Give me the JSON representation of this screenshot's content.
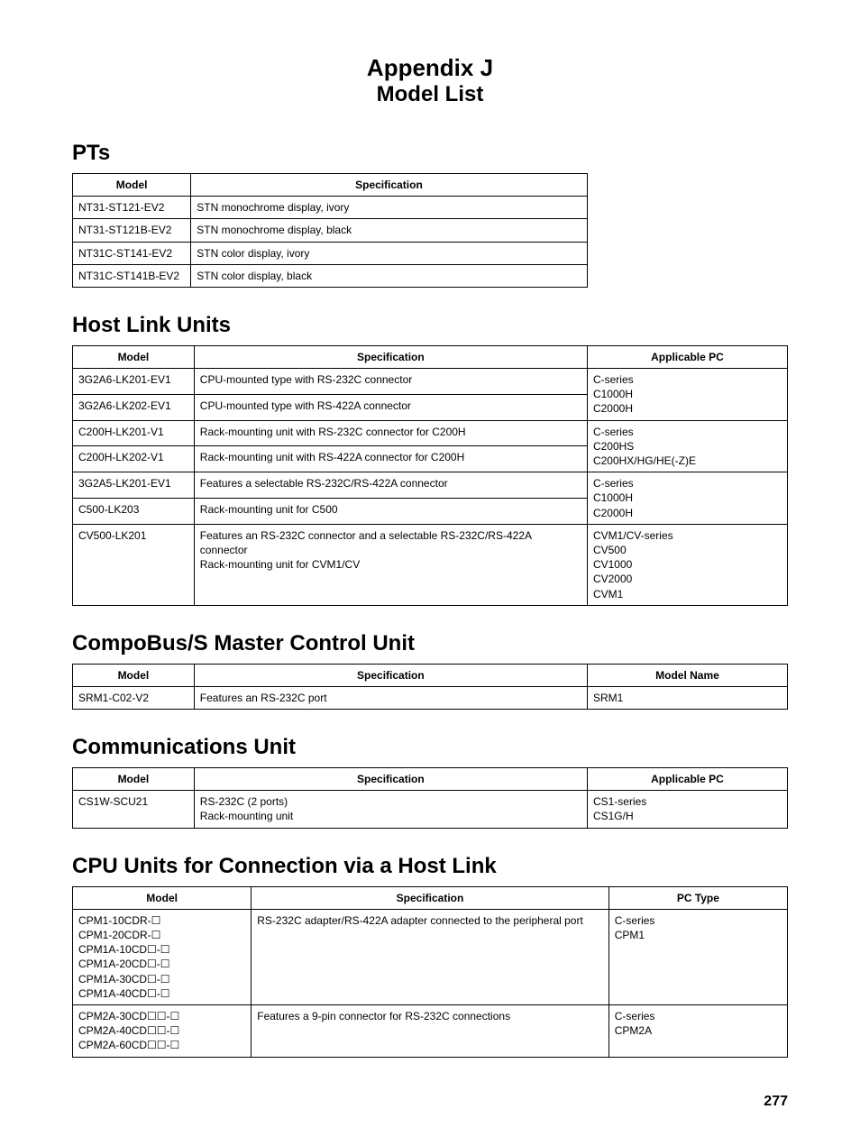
{
  "header": {
    "appendix": "Appendix J",
    "subtitle": "Model List"
  },
  "pts": {
    "heading": "PTs",
    "cols": [
      "Model",
      "Specification"
    ],
    "rows": [
      {
        "model": "NT31-ST121-EV2",
        "spec": "STN monochrome display, ivory"
      },
      {
        "model": "NT31-ST121B-EV2",
        "spec": "STN monochrome display, black"
      },
      {
        "model": "NT31C-ST141-EV2",
        "spec": "STN color display, ivory"
      },
      {
        "model": "NT31C-ST141B-EV2",
        "spec": "STN color display, black"
      }
    ]
  },
  "hostlink": {
    "heading": "Host Link Units",
    "cols": [
      "Model",
      "Specification",
      "Applicable PC"
    ],
    "rows": [
      {
        "model": "3G2A6-LK201-EV1",
        "spec": "CPU-mounted type with RS-232C connector",
        "pc_lines": [
          "C-series"
        ],
        "group_start": true
      },
      {
        "model": "3G2A6-LK202-EV1",
        "spec": "CPU-mounted type with RS-422A connector",
        "pc_lines": [
          "C1000H",
          "C2000H"
        ]
      },
      {
        "model": "C200H-LK201-V1",
        "spec": "Rack-mounting unit with RS-232C connector for C200H",
        "pc_lines": [
          "C-series"
        ],
        "group_start": true
      },
      {
        "model": "C200H-LK202-V1",
        "spec": "Rack-mounting unit with RS-422A connector for C200H",
        "pc_lines": [
          "C200HS",
          "C200HX/HG/HE(-Z)E"
        ]
      },
      {
        "model": "3G2A5-LK201-EV1",
        "spec": "Features a selectable RS-232C/RS-422A connector",
        "pc_lines": [
          "C-series"
        ],
        "group_start": true
      },
      {
        "model": "C500-LK203",
        "spec": "Rack-mounting unit for C500",
        "pc_lines": [
          "C1000H",
          "C2000H"
        ]
      },
      {
        "model": "CV500-LK201",
        "spec": "Features an RS-232C connector and a selectable RS-232C/RS-422A connector\nRack-mounting unit for CVM1/CV",
        "pc_lines": [
          "CVM1/CV-series",
          "CV500",
          "CV1000",
          "CV2000",
          "CVM1"
        ],
        "group_start": true,
        "single": true
      }
    ]
  },
  "compobus": {
    "heading": "CompoBus/S Master Control Unit",
    "cols": [
      "Model",
      "Specification",
      "Model Name"
    ],
    "rows": [
      {
        "model": "SRM1-C02-V2",
        "spec": "Features an RS-232C port",
        "name": "SRM1"
      }
    ]
  },
  "comm": {
    "heading": "Communications Unit",
    "cols": [
      "Model",
      "Specification",
      "Applicable PC"
    ],
    "rows": [
      {
        "model": "CS1W-SCU21",
        "spec": "RS-232C (2 ports)\nRack-mounting unit",
        "pc": "CS1-series\nCS1G/H"
      }
    ]
  },
  "cpu": {
    "heading": "CPU Units for Connection via a Host Link",
    "cols": [
      "Model",
      "Specification",
      "PC Type"
    ],
    "rows": [
      {
        "model": "CPM1-10CDR-☐\nCPM1-20CDR-☐\nCPM1A-10CD☐-☐\nCPM1A-20CD☐-☐\nCPM1A-30CD☐-☐\nCPM1A-40CD☐-☐",
        "spec": "RS-232C adapter/RS-422A adapter connected to the peripheral port",
        "pc": "C-series\nCPM1"
      },
      {
        "model": "CPM2A-30CD☐☐-☐\nCPM2A-40CD☐☐-☐\nCPM2A-60CD☐☐-☐",
        "spec": "Features a 9-pin connector for RS-232C connections",
        "pc": "C-series\nCPM2A"
      }
    ]
  },
  "page_number": "277"
}
